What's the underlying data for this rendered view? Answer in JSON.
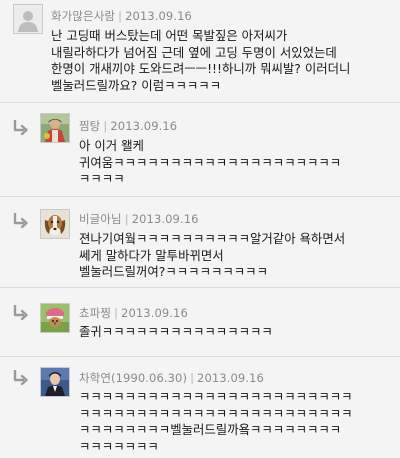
{
  "comments": [
    {
      "author": "화가많은사람",
      "date": "2013.09.16",
      "lines": [
        "난 고딩때 버스탔는데 어떤 목발짚은 아저씨가",
        "내릴라하다가 넘어짐 근데 옆에 고딩 두명이 서있었는데",
        "한명이 개새끼야 도와드려ㅡㅡ!!!하니까 뭐씨발? 이러더니",
        "벨눌러드릴까요? 이럼ㅋㅋㅋㅋㅋ"
      ]
    },
    {
      "author": "찜탕",
      "date": "2013.09.16",
      "lines": [
        "아 이거 왤케",
        "귀여움ㅋㅋㅋㅋㅋㅋㅋㅋㅋㅋㅋㅋㅋㅋㅋㅋㅋㅋㅋㅋ",
        "ㅋㅋㅋㅋ"
      ]
    },
    {
      "author": "비글아님",
      "date": "2013.09.16",
      "lines": [
        "젼나기여웤ㅋㅋㅋㅋㅋㅋㅋㅋㅋㅋ알거같아 욕하면서",
        "쎄게 말하다가 말투바뀌면서",
        "벨눌러드릴꺼여?ㅋㅋㅋㅋㅋㅋㅋㅋㅋ"
      ]
    },
    {
      "author": "쵸파찡",
      "date": "2013.09.16",
      "lines": [
        "졸귀ㅋㅋㅋㅋㅋㅋㅋㅋㅋㅋㅋㅋㅋㅋㅋ"
      ]
    },
    {
      "author": "차학연(1990.06.30)",
      "date": "2013.09.16",
      "lines": [
        "ㅋㅋㅋㅋㅋㅋㅋㅋㅋㅋㅋㅋㅋㅋㅋㅋㅋㅋㅋㅋㅋㅋㅋㅋ",
        "ㅋㅋㅋㅋㅋㅋㅋㅋㅋㅋㅋㅋㅋㅋㅋㅋㅋㅋㅋㅋㅋㅋㅋㅋ",
        "ㅋㅋㅋㅋㅋㅋㅋㅋ벨눌러드릴까욬ㅋㅋㅋㅋㅋㅋㅋㅋ",
        "ㅋㅋㅋㅋㅋㅋㅋ"
      ]
    }
  ]
}
